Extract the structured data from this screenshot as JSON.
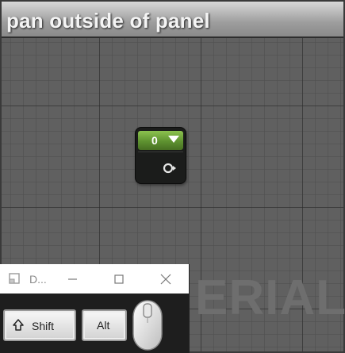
{
  "panel": {
    "title": "pan outside of panel",
    "watermark": "ERIAL"
  },
  "node": {
    "value": "0",
    "dropdown_icon": "triangle-down-icon",
    "output_pin_icon": "exec-pin-icon",
    "header_color": "#6aa23a"
  },
  "key_overlay_window": {
    "title": "D...",
    "app_icon": "app-window-icon",
    "minimize_icon": "minimize-icon",
    "maximize_icon": "maximize-icon",
    "close_icon": "close-icon",
    "keys": {
      "shift_label": "Shift",
      "alt_label": "Alt"
    },
    "mouse_icon": "mouse-icon"
  }
}
